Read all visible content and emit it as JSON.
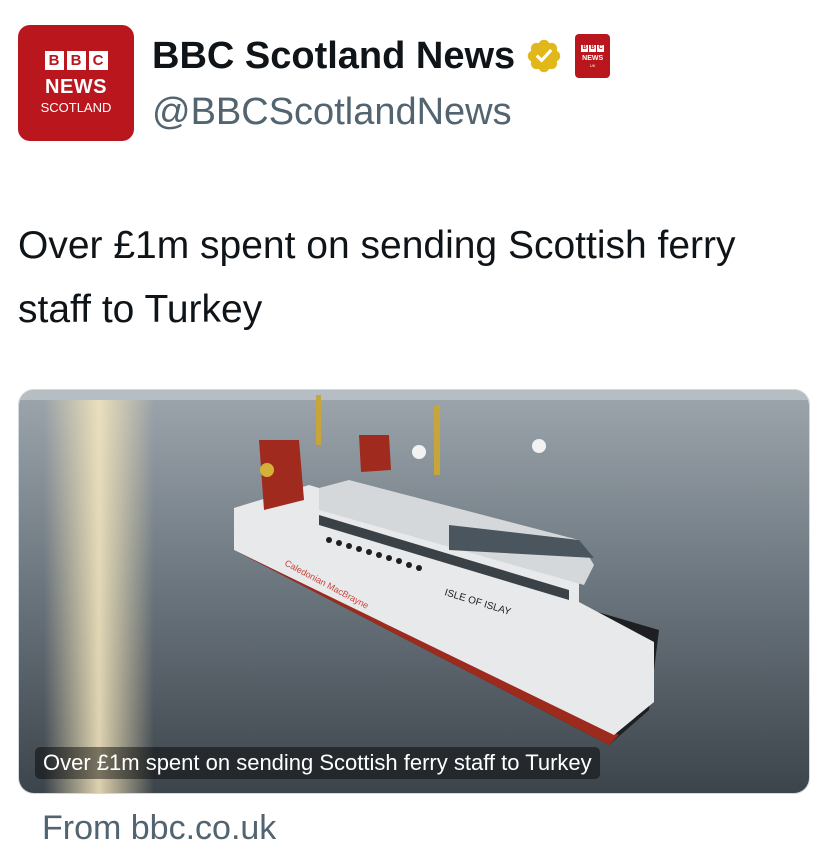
{
  "account": {
    "display_name": "BBC Scotland News",
    "handle": "@BBCScotlandNews",
    "avatar": {
      "bbc": [
        "B",
        "B",
        "C"
      ],
      "line1": "NEWS",
      "line2": "SCOTLAND"
    },
    "affiliate_badge": {
      "bbc": [
        "B",
        "B",
        "C"
      ],
      "line1": "NEWS",
      "line2": "UK"
    },
    "verified_icon": "gold-verified-badge-icon",
    "brand_color": "#b9161d"
  },
  "tweet": {
    "text": "Over £1m spent on sending Scottish ferry staff to Turkey"
  },
  "card": {
    "image_alt": "ferry-photo",
    "ship_name": "ISLE OF ISLAY",
    "hull_text": "Caledonian MacBrayne",
    "title": "Over £1m spent on sending Scottish ferry staff to Turkey",
    "source": "From bbc.co.uk"
  }
}
